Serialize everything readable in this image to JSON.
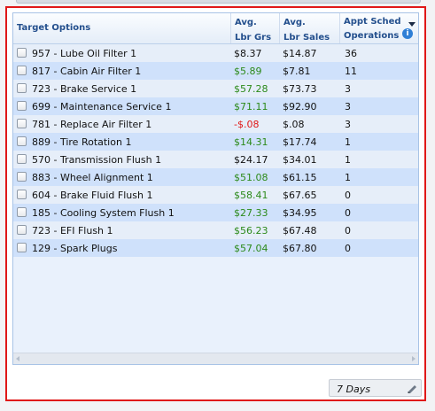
{
  "grid": {
    "columns": {
      "target": "Target Options",
      "grs_1": "Avg.",
      "grs_2": "Lbr Grs",
      "sales_1": "Avg.",
      "sales_2": "Lbr Sales",
      "appt_1": "Appt Sched",
      "appt_2": "Operations"
    },
    "rows": [
      {
        "name": "957 - Lube Oil Filter 1",
        "grs": "$8.37",
        "sales": "$14.87",
        "appt": "36",
        "grs_color": "#111111"
      },
      {
        "name": "817 - Cabin Air Filter 1",
        "grs": "$5.89",
        "sales": "$7.81",
        "appt": "11",
        "grs_color": "#2c8a1a"
      },
      {
        "name": "723 - Brake Service 1",
        "grs": "$57.28",
        "sales": "$73.73",
        "appt": "3",
        "grs_color": "#2c8a1a"
      },
      {
        "name": "699 - Maintenance Service 1",
        "grs": "$71.11",
        "sales": "$92.90",
        "appt": "3",
        "grs_color": "#2c8a1a"
      },
      {
        "name": "781 - Replace Air Filter 1",
        "grs": "-$.08",
        "sales": "$.08",
        "appt": "3",
        "grs_color": "#e01818"
      },
      {
        "name": "889 - Tire Rotation 1",
        "grs": "$14.31",
        "sales": "$17.74",
        "appt": "1",
        "grs_color": "#2c8a1a"
      },
      {
        "name": "570 - Transmission Flush 1",
        "grs": "$24.17",
        "sales": "$34.01",
        "appt": "1",
        "grs_color": "#111111"
      },
      {
        "name": "883 - Wheel Alignment 1",
        "grs": "$51.08",
        "sales": "$61.15",
        "appt": "1",
        "grs_color": "#2c8a1a"
      },
      {
        "name": "604 - Brake Fluid Flush 1",
        "grs": "$58.41",
        "sales": "$67.65",
        "appt": "0",
        "grs_color": "#2c8a1a"
      },
      {
        "name": "185 - Cooling System Flush 1",
        "grs": "$27.33",
        "sales": "$34.95",
        "appt": "0",
        "grs_color": "#2c8a1a"
      },
      {
        "name": "723 - EFI Flush 1",
        "grs": "$56.23",
        "sales": "$67.48",
        "appt": "0",
        "grs_color": "#2c8a1a"
      },
      {
        "name": "129 - Spark Plugs",
        "grs": "$57.04",
        "sales": "$67.80",
        "appt": "0",
        "grs_color": "#2c8a1a"
      }
    ]
  },
  "footer": {
    "period": "7 Days"
  },
  "icons": {
    "info": "info-icon",
    "sort": "sort-desc-icon",
    "edit": "pencil-icon"
  },
  "colors": {
    "panel_border": "#e01818",
    "header_text": "#234f8d",
    "positive": "#2c8a1a",
    "negative": "#e01818"
  }
}
